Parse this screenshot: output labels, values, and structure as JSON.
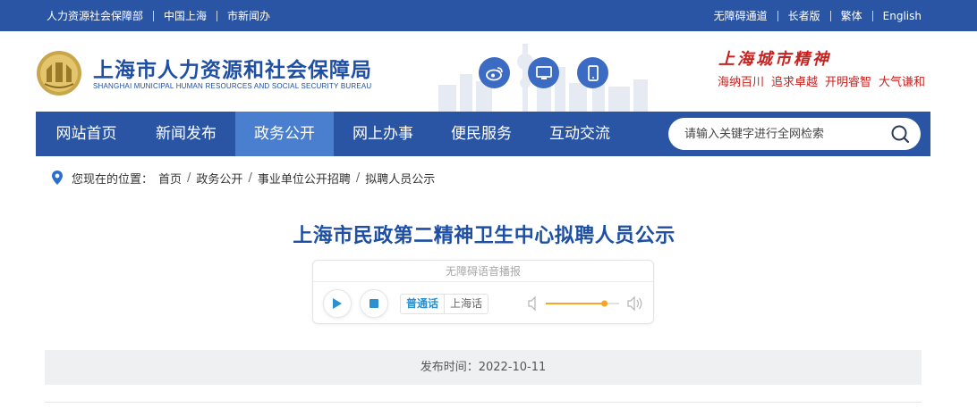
{
  "topbar": {
    "left_links": [
      "人力资源社会保障部",
      "中国上海",
      "市新闻办"
    ],
    "right_links": [
      "无障碍通道",
      "长者版",
      "繁体",
      "English"
    ]
  },
  "header": {
    "site_title": "上海市人力资源和社会保障局",
    "site_subtitle": "SHANGHAI MUNICIPAL HUMAN RESOURCES AND SOCIAL SECURITY BUREAU",
    "spirit_title": "上海城市精神",
    "spirit_words": [
      "海纳百川",
      "追求卓越",
      "开明睿智",
      "大气谦和"
    ]
  },
  "nav": {
    "tabs": [
      "网站首页",
      "新闻发布",
      "政务公开",
      "网上办事",
      "便民服务",
      "互动交流"
    ],
    "active_index": 2,
    "search_placeholder": "请输入关键字进行全网检索"
  },
  "breadcrumb": {
    "label": "您现在的位置：",
    "items": [
      "首页",
      "政务公开",
      "事业单位公开招聘",
      "拟聘人员公示"
    ]
  },
  "article": {
    "title": "上海市民政第二精神卫生中心拟聘人员公示",
    "publish_time": "发布时间：2022-10-11"
  },
  "player": {
    "title": "无障碍语音播报",
    "dialects": [
      "普通话",
      "上海话"
    ],
    "selected_dialect": "普通话",
    "volume": 0.8
  },
  "colors": {
    "brand_blue": "#2a55a5",
    "active_tab": "#4a7fcf",
    "spirit_red": "#c7221f",
    "player_accent": "#2c8fcf"
  },
  "icons": {
    "header": [
      "weibo-icon",
      "monitor-icon",
      "mobile-icon"
    ],
    "search": "search-icon",
    "breadcrumb": "location-pin-icon",
    "player": [
      "play-icon",
      "stop-icon",
      "volume-low-icon",
      "volume-high-icon"
    ]
  }
}
